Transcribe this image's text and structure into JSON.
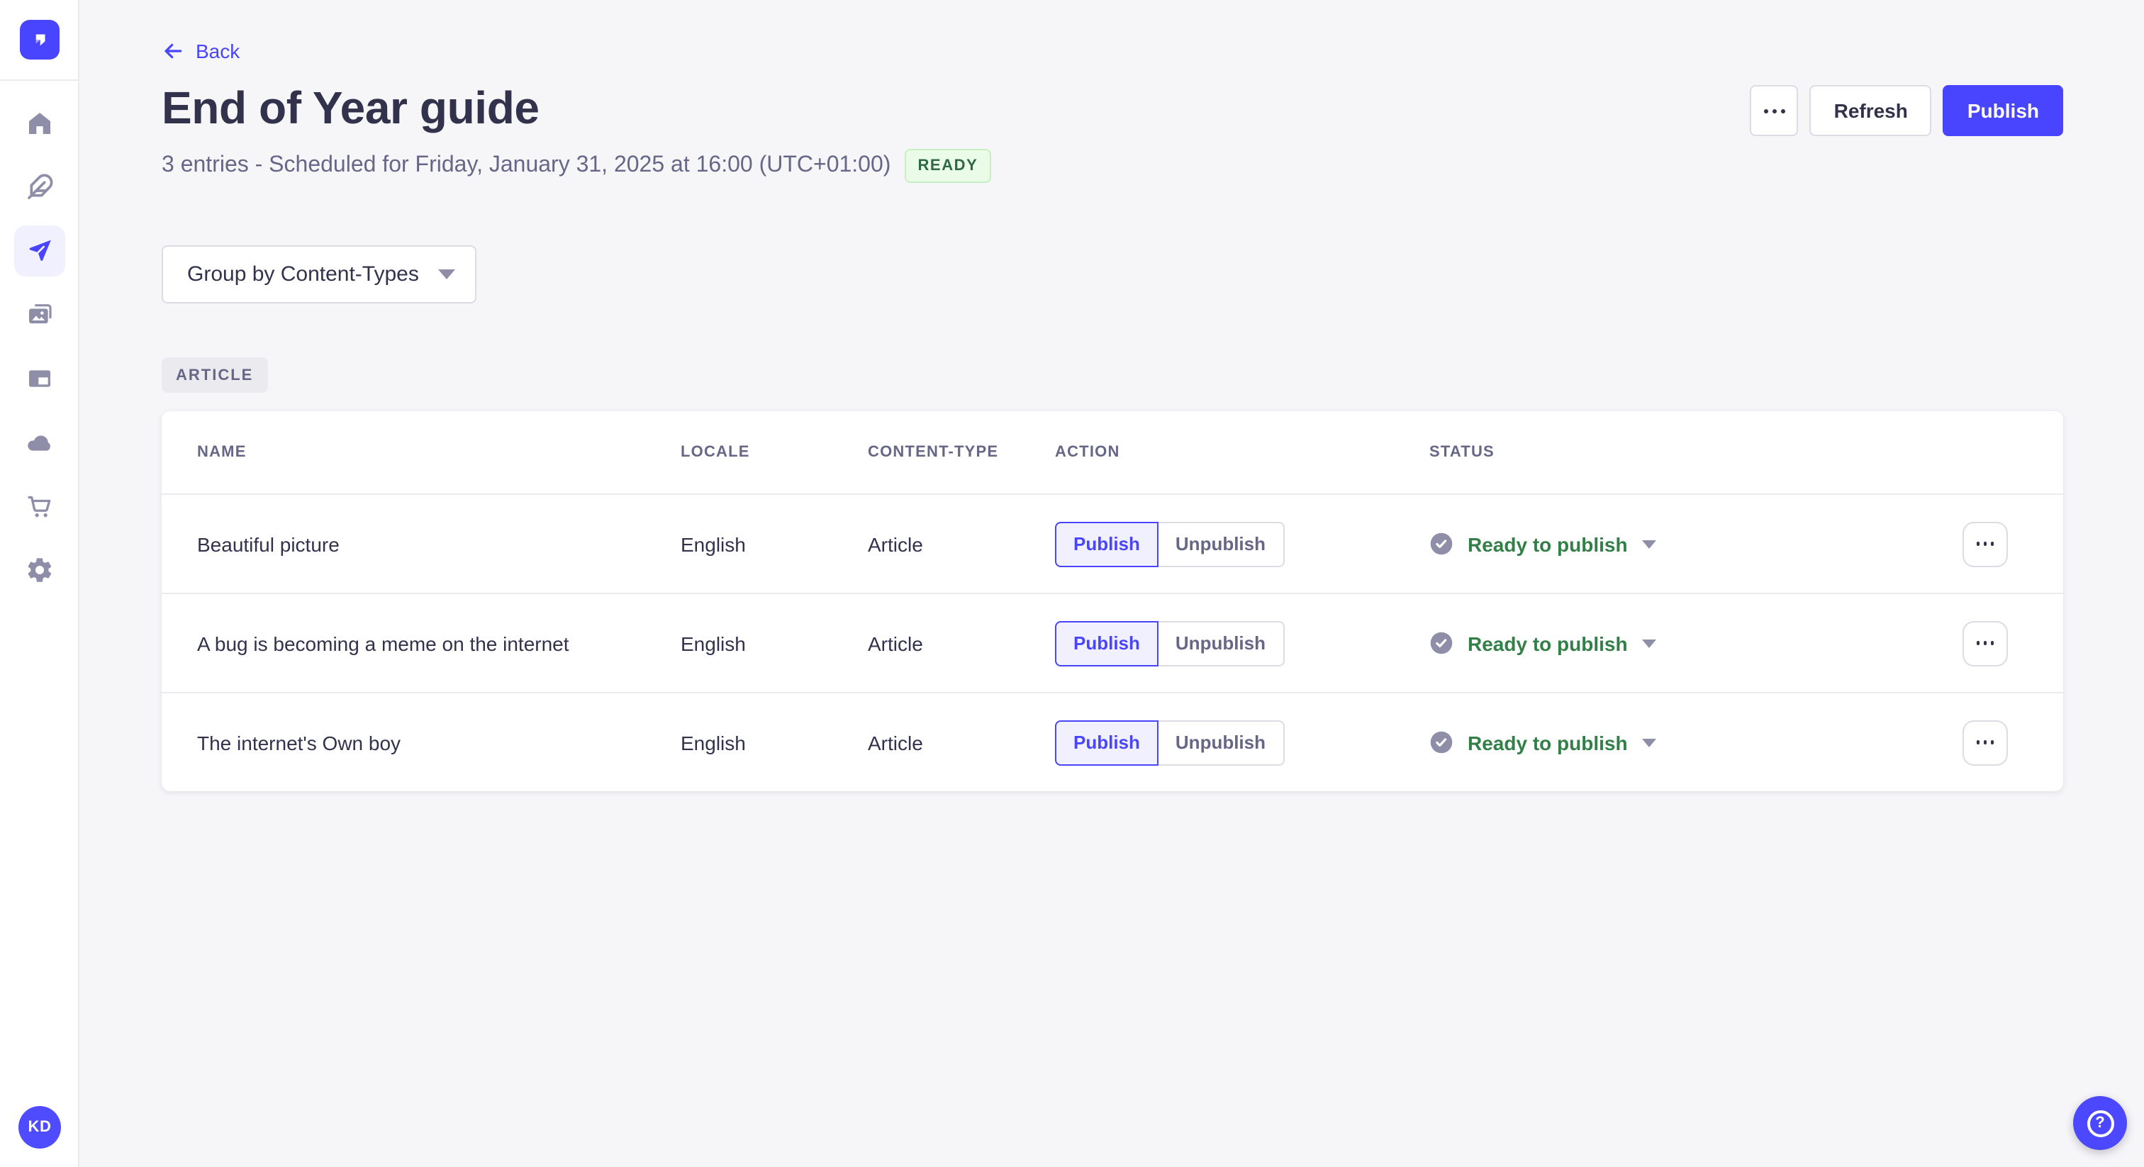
{
  "colors": {
    "primary": "#4945ff",
    "primary_light": "#f0f0ff",
    "page_bg": "#f6f6f9",
    "border": "#dcdce4",
    "divider": "#eaeaef",
    "icon_gray": "#8e8ea9",
    "text": "#32324d",
    "text_muted": "#666687",
    "success_text": "#328048",
    "ready_badge_bg": "#eafbe7",
    "ready_badge_border": "#c6f0c2",
    "ready_badge_text": "#2f6846"
  },
  "sidebar": {
    "logo_icon": "strapi-logo",
    "nav_icons": [
      "home-icon",
      "feather-icon",
      "paper-plane-icon",
      "images-icon",
      "layout-icon",
      "cloud-icon",
      "cart-icon",
      "gear-icon"
    ],
    "active_item": "paper-plane",
    "avatar_initials": "KD"
  },
  "header": {
    "back_label": "Back",
    "title": "End of Year guide",
    "subtitle": "3 entries - Scheduled for Friday, January 31, 2025 at 16:00 (UTC+01:00)",
    "ready_badge": "READY",
    "refresh_label": "Refresh",
    "publish_label": "Publish",
    "more_icon": "ellipsis-icon"
  },
  "toolbar": {
    "group_by_label": "Group by Content-Types"
  },
  "content_group": {
    "label": "ARTICLE"
  },
  "table": {
    "columns": [
      "NAME",
      "LOCALE",
      "CONTENT-TYPE",
      "ACTION",
      "STATUS"
    ],
    "rows": [
      {
        "name": "Beautiful picture",
        "locale": "English",
        "content_type": "Article",
        "publish_label": "Publish",
        "unpublish_label": "Unpublish",
        "status_label": "Ready to publish"
      },
      {
        "name": "A bug is becoming a meme on the internet",
        "locale": "English",
        "content_type": "Article",
        "publish_label": "Publish",
        "unpublish_label": "Unpublish",
        "status_label": "Ready to publish"
      },
      {
        "name": "The internet's Own boy",
        "locale": "English",
        "content_type": "Article",
        "publish_label": "Publish",
        "unpublish_label": "Unpublish",
        "status_label": "Ready to publish"
      }
    ]
  },
  "help": {
    "glyph": "?"
  }
}
